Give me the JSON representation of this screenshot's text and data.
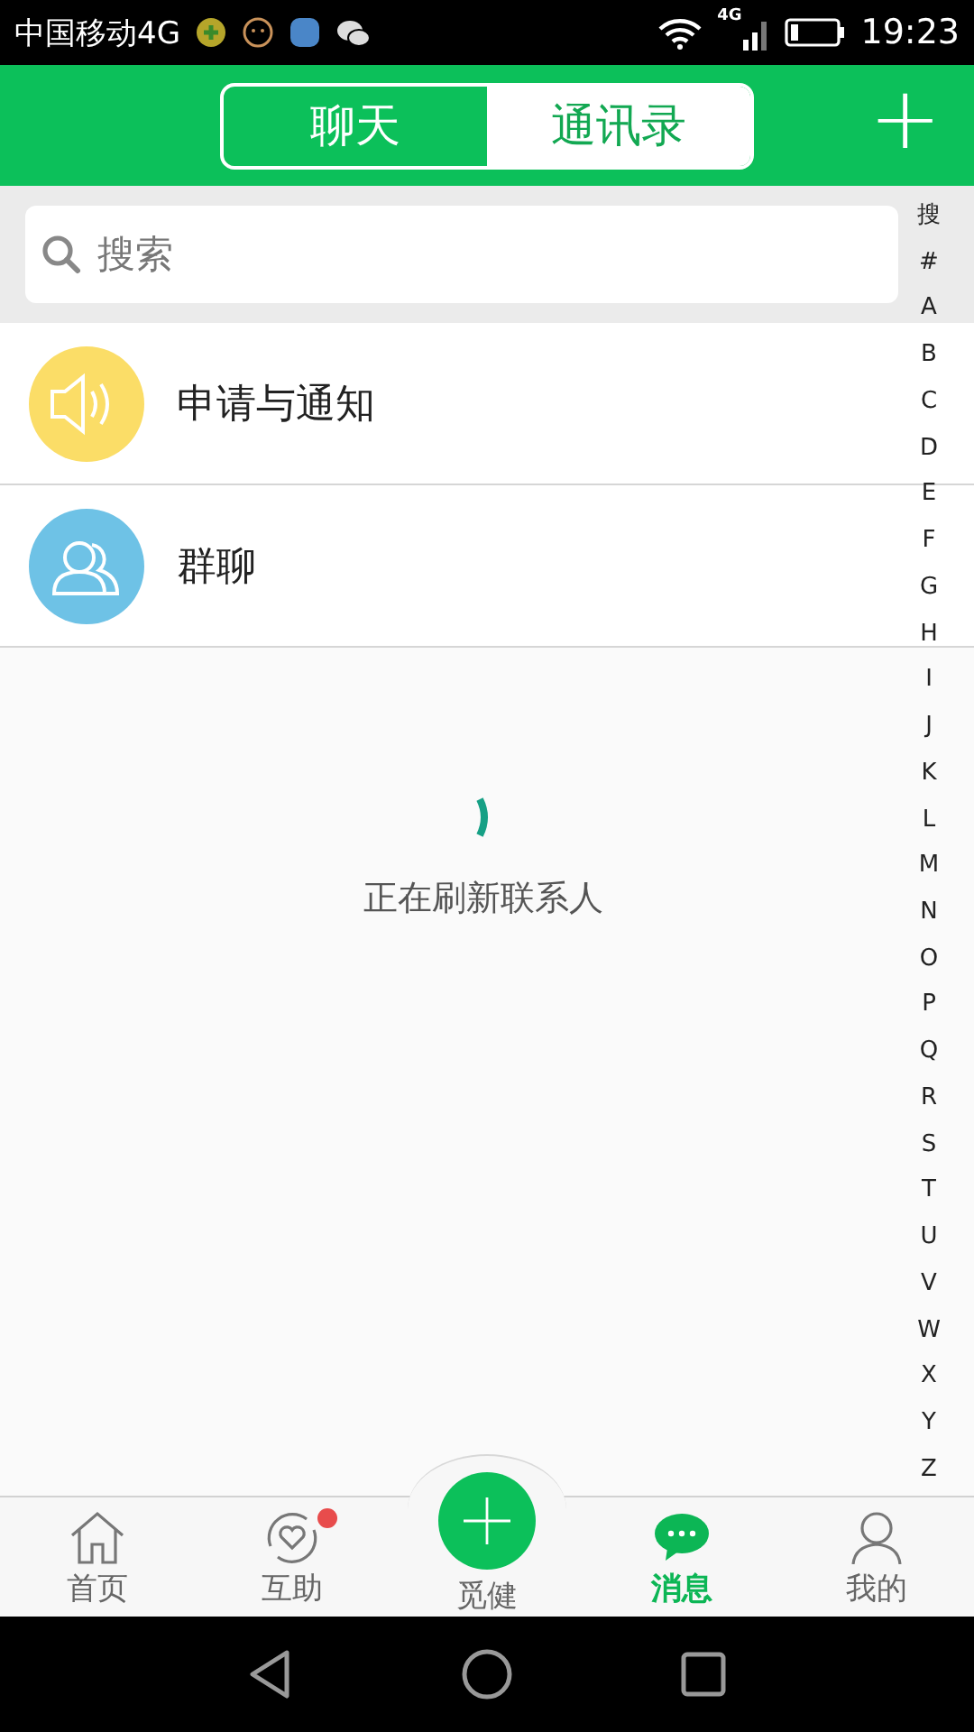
{
  "status_bar": {
    "carrier": "中国移动4G",
    "network": "4G",
    "time": "19:23"
  },
  "header": {
    "tabs": [
      {
        "label": "聊天",
        "selected": false
      },
      {
        "label": "通讯录",
        "selected": true
      }
    ],
    "add_button": "+"
  },
  "search": {
    "placeholder": "搜索"
  },
  "contacts": [
    {
      "kind": "notice",
      "label": "申请与通知",
      "color": "#fbdd67"
    },
    {
      "kind": "group",
      "label": "群聊",
      "color": "#6ec2e6"
    }
  ],
  "loading": {
    "text": "正在刷新联系人"
  },
  "index": [
    "搜",
    "#",
    "A",
    "B",
    "C",
    "D",
    "E",
    "F",
    "G",
    "H",
    "I",
    "J",
    "K",
    "L",
    "M",
    "N",
    "O",
    "P",
    "Q",
    "R",
    "S",
    "T",
    "U",
    "V",
    "W",
    "X",
    "Y",
    "Z"
  ],
  "tab_bar": [
    {
      "kind": "home",
      "label": "首页",
      "selected": false,
      "badge": false
    },
    {
      "kind": "mutual",
      "label": "互助",
      "selected": false,
      "badge": true
    },
    {
      "kind": "center",
      "label": "觅健",
      "selected": false,
      "badge": false
    },
    {
      "kind": "chat",
      "label": "消息",
      "selected": true,
      "badge": false
    },
    {
      "kind": "profile",
      "label": "我的",
      "selected": false,
      "badge": false
    }
  ]
}
